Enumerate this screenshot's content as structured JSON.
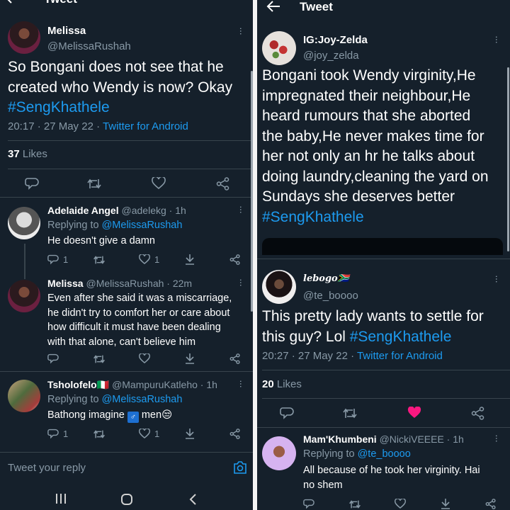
{
  "left": {
    "header_title": "Tweet",
    "main_tweet": {
      "name": "Melissa",
      "handle": "@MelissaRushah",
      "text_lines": [
        "So Bongani does not see that he",
        "created who Wendy is now? Okay"
      ],
      "hashtag": "#SengKhathele",
      "time": "20:17 · 27 May 22 · ",
      "source": "Twitter for Android",
      "likes_count": "37",
      "likes_label": "Likes"
    },
    "replies": [
      {
        "name": "Adelaide Angel",
        "meta": "@adelekg · 1h",
        "replying_label": "Replying to ",
        "replying_to": "@MelissaRushah",
        "text": "He doesn't give a damn",
        "reply_count": "1",
        "like_count": "1"
      },
      {
        "name": "Melissa",
        "meta": "@MelissaRushah · 22m",
        "text_lines": [
          "Even after she said it was a miscarriage,",
          "he didn't try to comfort her or care about",
          "how difficult it must have been dealing",
          "with that alone, can't believe him"
        ]
      },
      {
        "name": "Tsholofelo🇮🇹",
        "meta": "@MampuruKatleho · 1h",
        "replying_label": "Replying to ",
        "replying_to": "@MelissaRushah",
        "text": "Bathong imagine",
        "text_end": " men😒",
        "reply_count": "1",
        "like_count": "1"
      }
    ],
    "reply_placeholder": "Tweet your reply"
  },
  "right": {
    "header_title": "Tweet",
    "main_tweet": {
      "name": "IG:Joy-Zelda",
      "handle": "@joy_zelda",
      "text_lines": [
        "Bongani took Wendy virginity,He",
        "impregnated their neighbour,He",
        "heard rumours that she aborted",
        "the baby,He never makes time for",
        "her not only an hr he talks about",
        "doing laundry,cleaning the yard on",
        "Sundays she deserves better"
      ],
      "hashtag": "#SengKhathele"
    },
    "second_tweet": {
      "name": "lebogo🇿🇦",
      "handle": "@te_boooo",
      "text_lines": [
        "This pretty lady wants to settle for",
        "this guy? Lol "
      ],
      "hashtag": "#SengKhathele",
      "time": "20:27 · 27 May 22 · ",
      "source": "Twitter for Android",
      "likes_count": "20",
      "likes_label": "Likes"
    },
    "reply": {
      "name": "Mam'Khumbeni",
      "meta": "@NickiVEEEE · 1h",
      "replying_label": "Replying to ",
      "replying_to": "@te_boooo",
      "text_lines": [
        "All because of he took her virginity. Hai",
        "no shem"
      ]
    }
  },
  "colors": {
    "background": "#15202b",
    "accent": "#1d9bf0",
    "muted": "#8899a6",
    "divider": "#38444d",
    "like_active": "#f91880"
  },
  "icons": [
    "back-arrow-icon",
    "more-icon",
    "reply-icon",
    "retweet-icon",
    "like-icon",
    "share-icon",
    "download-icon",
    "camera-icon",
    "recent-apps-icon",
    "home-icon",
    "back-icon"
  ]
}
